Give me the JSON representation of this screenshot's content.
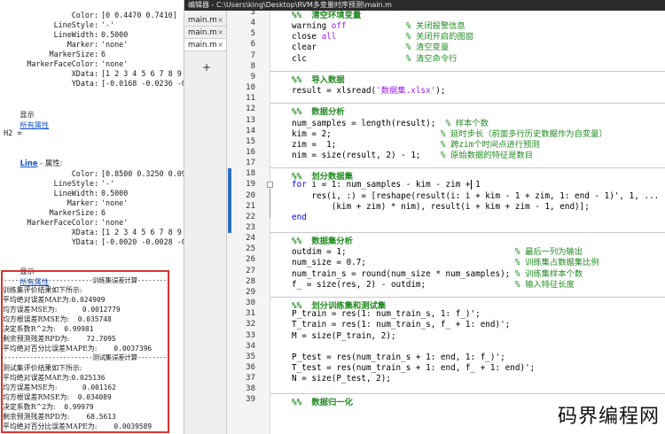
{
  "command_window": {
    "h1_props": [
      {
        "k": "Color:",
        "v": "[0 0.4470 0.7410]"
      },
      {
        "k": "LineStyle:",
        "v": "'-'"
      },
      {
        "k": "LineWidth:",
        "v": "0.5000"
      },
      {
        "k": "Marker:",
        "v": "'none'"
      },
      {
        "k": "MarkerSize:",
        "v": "6"
      },
      {
        "k": "MarkerFaceColor:",
        "v": "'none'"
      },
      {
        "k": "XData:",
        "v": "[1 2 3 4 5 6 7 8 9 10"
      },
      {
        "k": "YData:",
        "v": "[-0.0168 -0.0236 -0.0"
      }
    ],
    "show_label": "显示",
    "all_props_link": "所有属性",
    "h2_label": "H2 =",
    "line_link": "Line",
    "line_suffix": " - 属性:",
    "h2_props": [
      {
        "k": "Color:",
        "v": "[0.8500 0.3250 0.0980"
      },
      {
        "k": "LineStyle:",
        "v": "'-'"
      },
      {
        "k": "LineWidth:",
        "v": "0.5000"
      },
      {
        "k": "Marker:",
        "v": "'none'"
      },
      {
        "k": "MarkerSize:",
        "v": "6"
      },
      {
        "k": "MarkerFaceColor:",
        "v": "'none'"
      },
      {
        "k": "XData:",
        "v": "[1 2 3 4 5 6 7 8 9 10"
      },
      {
        "k": "YData:",
        "v": "[-0.0020 -0.0028 -0.0"
      }
    ],
    "results": {
      "train_sep": "-------------------------训练集误差计算--------",
      "train_header": "训练集评价结果如下所示:",
      "train": [
        {
          "label": "平均绝对误差MAE为:",
          "value": "0.024909"
        },
        {
          "label": "均方误差MSE为:",
          "value": "      0.0012779"
        },
        {
          "label": "均方根误差RMSE为:",
          "value": "  0.035748"
        },
        {
          "label": "决定系数R^2为:",
          "value": "  0.99981"
        },
        {
          "label": "剩余预测残差RPD为:",
          "value": "    72.7095"
        },
        {
          "label": "平均绝对百分比误差MAPE为:",
          "value": "    0.0037396"
        }
      ],
      "test_sep": "-------------------------测试集误差计算--------",
      "test_header": "测试集评价结果如下所示:",
      "test": [
        {
          "label": "平均绝对误差MAE为:",
          "value": "0.025136"
        },
        {
          "label": "均方误差MSE为:",
          "value": "      0.001162"
        },
        {
          "label": "均方根误差RMSE为:",
          "value": "  0.034089"
        },
        {
          "label": "决定系数R^2为:",
          "value": "  0.99979"
        },
        {
          "label": "剩余预测残差RPD为:",
          "value": "    68.5613"
        },
        {
          "label": "平均绝对百分比误差MAPE为:",
          "value": "    0.0039589"
        }
      ]
    }
  },
  "editor": {
    "title": "编辑器 - C:\\Users\\king\\Desktop\\RVM多变量时序预测\\main.m",
    "tabs": [
      "main.m",
      "main.m",
      "main.m"
    ],
    "tab_close": "×",
    "tab_add": "+",
    "lines": [
      {
        "n": "3",
        "parts": [
          [
            "sect",
            "%%  清空环境变量"
          ]
        ]
      },
      {
        "n": "4",
        "parts": [
          [
            "",
            "warning "
          ],
          [
            "str",
            "off"
          ],
          [
            "",
            "            "
          ],
          [
            "cm",
            "% 关闭报警信息"
          ]
        ]
      },
      {
        "n": "5",
        "parts": [
          [
            "",
            "close "
          ],
          [
            "str",
            "all"
          ],
          [
            "",
            "              "
          ],
          [
            "cm",
            "% 关闭开启的图窗"
          ]
        ]
      },
      {
        "n": "6",
        "parts": [
          [
            "",
            "clear"
          ],
          [
            "",
            "                  "
          ],
          [
            "cm",
            "% 清空变量"
          ]
        ]
      },
      {
        "n": "7",
        "parts": [
          [
            "",
            "clc"
          ],
          [
            "",
            "                    "
          ],
          [
            "cm",
            "% 清空命令行"
          ]
        ]
      },
      {
        "n": "8",
        "parts": []
      },
      {
        "n": "9",
        "parts": [
          [
            "sect",
            "%%  导入数据"
          ]
        ]
      },
      {
        "n": "10",
        "parts": [
          [
            "",
            "result = xlsread("
          ],
          [
            "str",
            "'数据集.xlsx'"
          ],
          [
            "",
            ");"
          ]
        ]
      },
      {
        "n": "11",
        "parts": []
      },
      {
        "n": "12",
        "parts": [
          [
            "sect",
            "%%  数据分析"
          ]
        ]
      },
      {
        "n": "13",
        "parts": [
          [
            "",
            "num_samples = length(result);  "
          ],
          [
            "cm",
            "% 样本个数"
          ]
        ]
      },
      {
        "n": "14",
        "parts": [
          [
            "",
            "kim = 2;                      "
          ],
          [
            "cm",
            "% 延时步长（前面多行历史数据作为自变量）"
          ]
        ]
      },
      {
        "n": "15",
        "parts": [
          [
            "",
            "zim =  1;                     "
          ],
          [
            "cm",
            "% 跨zim个时间点进行预测"
          ]
        ]
      },
      {
        "n": "16",
        "parts": [
          [
            "",
            "nim = size(result, 2) - 1;    "
          ],
          [
            "cm",
            "% 原始数据的特征是数目"
          ]
        ]
      },
      {
        "n": "17",
        "parts": []
      },
      {
        "n": "18",
        "parts": [
          [
            "sect",
            "%%  划分数据集"
          ]
        ]
      },
      {
        "n": "19",
        "parts": [
          [
            "kw",
            "for"
          ],
          [
            "",
            " i = 1: num_samples - kim - zim + 1"
          ]
        ]
      },
      {
        "n": "20",
        "parts": [
          [
            "",
            "    res(i, :) = [reshape(result(i: i + kim - 1 + zim, 1: end - 1)', 1, ..."
          ]
        ]
      },
      {
        "n": "21",
        "parts": [
          [
            "",
            "        (kim + zim) * nim), result(i + kim + zim - 1, end)];"
          ]
        ]
      },
      {
        "n": "22",
        "parts": [
          [
            "kw",
            "end"
          ]
        ]
      },
      {
        "n": "23",
        "parts": []
      },
      {
        "n": "24",
        "parts": [
          [
            "sect",
            "%%  数据集分析"
          ]
        ]
      },
      {
        "n": "25",
        "parts": [
          [
            "",
            "outdim = 1;                                  "
          ],
          [
            "cm",
            "% 最后一列为输出"
          ]
        ]
      },
      {
        "n": "26",
        "parts": [
          [
            "",
            "num_size = 0.7;                              "
          ],
          [
            "cm",
            "% 训练集占数据集比例"
          ]
        ]
      },
      {
        "n": "27",
        "parts": [
          [
            "",
            "num_train_s = round(num_size * num_samples); "
          ],
          [
            "cm",
            "% 训练集样本个数"
          ]
        ]
      },
      {
        "n": "28",
        "parts": [
          [
            "",
            "f_ = size(res, 2) - outdim;                  "
          ],
          [
            "cm",
            "% 输入特征长度"
          ]
        ]
      },
      {
        "n": "29",
        "parts": []
      },
      {
        "n": "30",
        "parts": [
          [
            "sect",
            "%%  划分训练集和测试集"
          ]
        ]
      },
      {
        "n": "31",
        "parts": [
          [
            "",
            "P_train = res(1: num_train_s, 1: f_)';"
          ]
        ]
      },
      {
        "n": "32",
        "parts": [
          [
            "",
            "T_train = res(1: num_train_s, f_ + 1: end)';"
          ]
        ]
      },
      {
        "n": "33",
        "parts": [
          [
            "",
            "M = size(P_train, 2);"
          ]
        ]
      },
      {
        "n": "34",
        "parts": []
      },
      {
        "n": "35",
        "parts": [
          [
            "",
            "P_test = res(num_train_s + 1: end, 1: f_)';"
          ]
        ]
      },
      {
        "n": "36",
        "parts": [
          [
            "",
            "T_test = res(num_train_s + 1: end, f_ + 1: end)';"
          ]
        ]
      },
      {
        "n": "37",
        "parts": [
          [
            "",
            "N = size(P_test, 2);"
          ]
        ]
      },
      {
        "n": "38",
        "parts": []
      },
      {
        "n": "39",
        "parts": [
          [
            "sect",
            "%%  数据归一化"
          ]
        ]
      }
    ]
  },
  "watermark": "码界编程网"
}
